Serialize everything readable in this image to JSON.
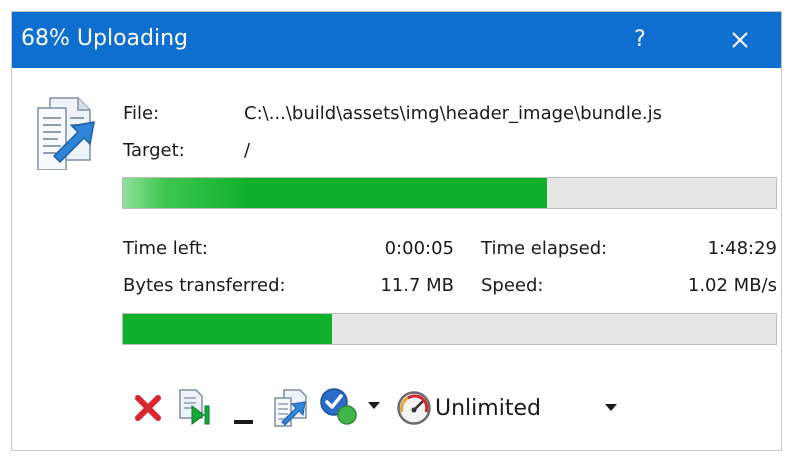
{
  "window": {
    "title": "68% Uploading",
    "help_label": "?"
  },
  "info": {
    "file_label": "File:",
    "file_value": "C:\\...\\build\\assets\\img\\header_image\\bundle.js",
    "target_label": "Target:",
    "target_value": "/"
  },
  "file_progress": 0.65,
  "stats": {
    "time_left_label": "Time left:",
    "time_left_value": "0:00:05",
    "time_elapsed_label": "Time elapsed:",
    "time_elapsed_value": "1:48:29",
    "bytes_label": "Bytes transferred:",
    "bytes_value": "11.7 MB",
    "speed_label": "Speed:",
    "speed_value": "1.02 MB/s"
  },
  "total_progress": 0.32,
  "toolbar": {
    "cancel_icon": "red-x-icon",
    "skip_icon": "skip-file-icon",
    "minimize_icon": "minimize-icon",
    "queue_icon": "transfer-queue-icon",
    "done_icon": "check-action-icon",
    "speed_limit_value": "Unlimited"
  },
  "colors": {
    "titlebar": "#0f6fd0",
    "progress_fill": "#0fb02a",
    "progress_track": "#e6e6e6",
    "cancel_red": "#d8262e"
  }
}
